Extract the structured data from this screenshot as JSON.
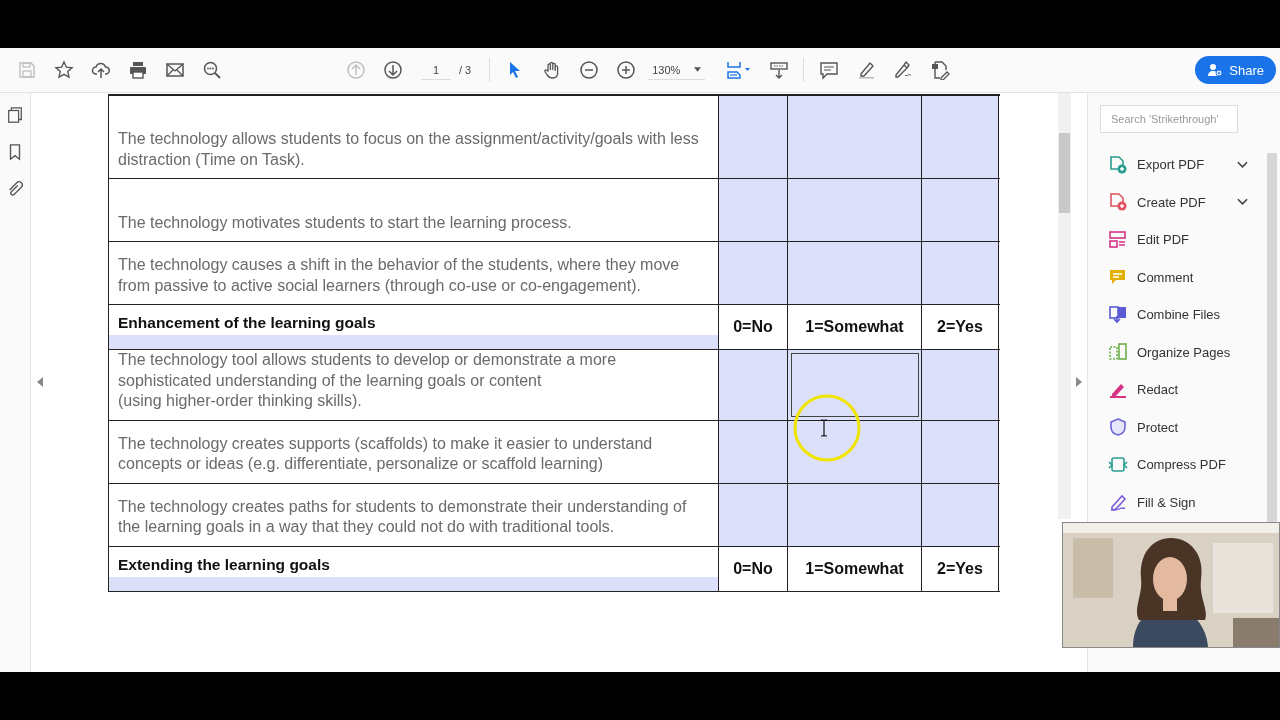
{
  "toolbar": {
    "save_disabled": true,
    "prev_page_disabled": true,
    "page_number": "1",
    "page_count": "/ 3",
    "nav_tools": [
      {
        "selected": true
      },
      {
        "selected": false
      }
    ],
    "zoom": "130%",
    "share": "Share"
  },
  "document": {
    "rows": [
      {
        "kind": "item",
        "text": "The technology allows students to focus on the assignment/activity/goals with less distraction (Time on Task).",
        "cells": [
          {
            "selected": false
          },
          {
            "selected": false
          },
          {
            "selected": false
          }
        ]
      },
      {
        "kind": "item",
        "text": "The technology motivates students to start the learning process.",
        "cells": [
          {
            "selected": false
          },
          {
            "selected": false
          },
          {
            "selected": false
          }
        ]
      },
      {
        "kind": "item",
        "text": "The technology causes a shift in the behavior of the students, where they move from passive to active social learners (through co-use or co-engagement).",
        "cells": [
          {
            "selected": false
          },
          {
            "selected": false
          },
          {
            "selected": false
          }
        ]
      },
      {
        "kind": "header",
        "text": "Enhancement of the learning goals",
        "labels": [
          "0=No",
          "1=Somewhat",
          "2=Yes"
        ]
      },
      {
        "kind": "item",
        "text": "The technology tool allows students to develop or demonstrate a more sophisticated understanding of the learning goals or content\n(using higher-order thinking skills).",
        "cells": [
          {
            "selected": false
          },
          {
            "selected": true
          },
          {
            "selected": false
          }
        ]
      },
      {
        "kind": "item",
        "text": "The technology creates supports (scaffolds) to make it easier to understand concepts or ideas (e.g. differentiate, personalize or scaffold learning)",
        "cells": [
          {
            "selected": false
          },
          {
            "selected": false
          },
          {
            "selected": false
          }
        ]
      },
      {
        "kind": "item",
        "text": "The technology creates paths for students to demonstrate their understanding of the learning goals in a way that they could not do with traditional tools.",
        "cells": [
          {
            "selected": false
          },
          {
            "selected": false
          },
          {
            "selected": false
          }
        ]
      },
      {
        "kind": "header",
        "text": "Extending the learning goals",
        "labels": [
          "0=No",
          "1=Somewhat",
          "2=Yes"
        ]
      }
    ]
  },
  "tools_panel": {
    "search": {
      "placeholder": "Search 'Strikethrough'"
    },
    "items": [
      {
        "label": "Export PDF",
        "expandable": true
      },
      {
        "label": "Create PDF",
        "expandable": true
      },
      {
        "label": "Edit PDF",
        "expandable": false
      },
      {
        "label": "Comment",
        "expandable": false
      },
      {
        "label": "Combine Files",
        "expandable": false
      },
      {
        "label": "Organize Pages",
        "expandable": false
      },
      {
        "label": "Redact",
        "expandable": false
      },
      {
        "label": "Protect",
        "expandable": false
      },
      {
        "label": "Compress PDF",
        "expandable": false
      },
      {
        "label": "Fill & Sign",
        "expandable": false
      }
    ]
  }
}
